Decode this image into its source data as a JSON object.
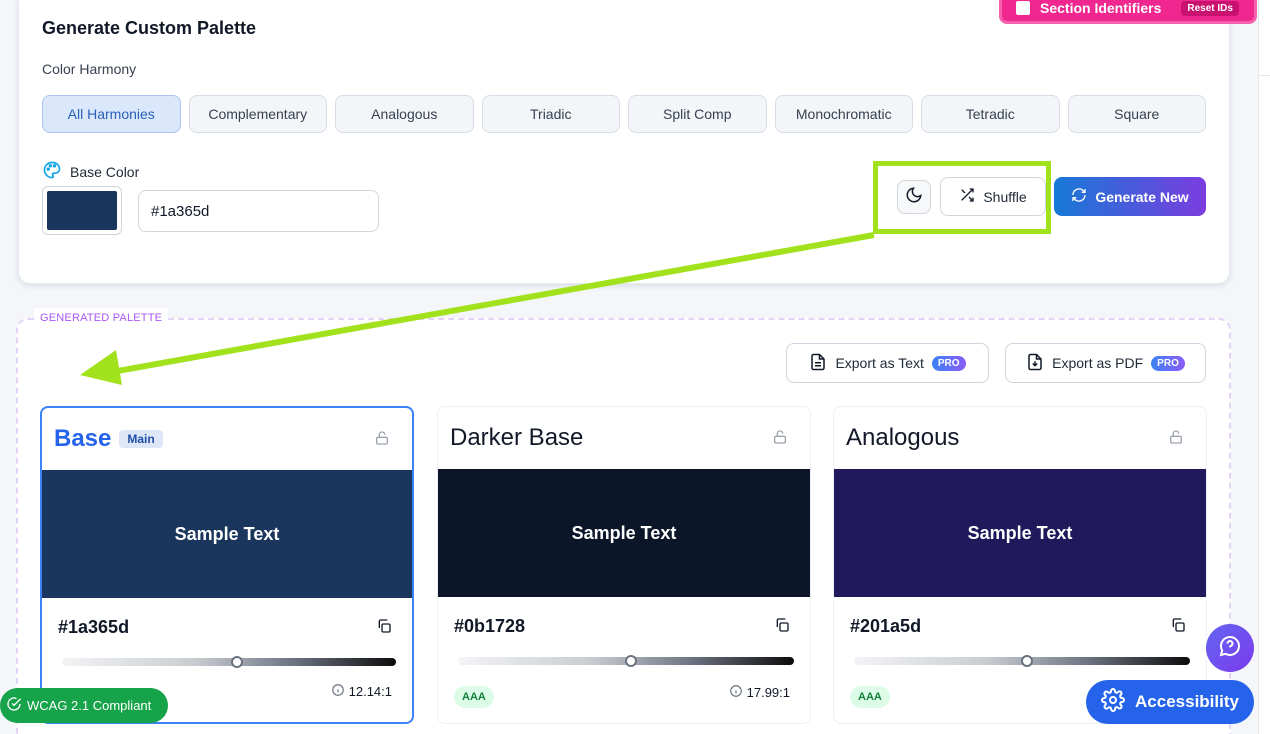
{
  "header": {
    "title": "Generate Custom Palette",
    "harmony_label": "Color Harmony",
    "harmonies": [
      {
        "label": "All Harmonies",
        "active": true
      },
      {
        "label": "Complementary",
        "active": false
      },
      {
        "label": "Analogous",
        "active": false
      },
      {
        "label": "Triadic",
        "active": false
      },
      {
        "label": "Split Comp",
        "active": false
      },
      {
        "label": "Monochromatic",
        "active": false
      },
      {
        "label": "Tetradic",
        "active": false
      },
      {
        "label": "Square",
        "active": false
      }
    ],
    "base_color_label": "Base Color",
    "base_color_value": "#1a365d",
    "shuffle_label": "Shuffle",
    "generate_label": "Generate New"
  },
  "section_identifiers": {
    "label": "Section Identifiers",
    "reset_label": "Reset IDs"
  },
  "palette": {
    "section_tag": "GENERATED PALETTE",
    "export_text_label": "Export as Text",
    "export_pdf_label": "Export as PDF",
    "pro_label": "PRO",
    "cards": [
      {
        "name": "Base",
        "badge": "Main",
        "color": "#1a365d",
        "hex": "#1a365d",
        "sample": "Sample Text",
        "rating": "",
        "ratio": "12.14:1",
        "slider": 0.5
      },
      {
        "name": "Darker Base",
        "badge": "",
        "color": "#0b1728",
        "hex": "#0b1728",
        "sample": "Sample Text",
        "rating": "AAA",
        "ratio": "17.99:1",
        "slider": 0.5
      },
      {
        "name": "Analogous",
        "badge": "",
        "color": "#201a5d",
        "hex": "#201a5d",
        "sample": "Sample Text",
        "rating": "AAA",
        "ratio": "",
        "slider": 0.5
      }
    ]
  },
  "floating": {
    "wcag_label": "WCAG 2.1 Compliant",
    "accessibility_label": "Accessibility"
  },
  "colors": {
    "annotation": "#a2e21d",
    "primary": "#2563eb",
    "accent_pink": "#f0278f"
  },
  "icons": [
    "palette-icon",
    "moon-icon",
    "shuffle-icon",
    "refresh-icon",
    "file-text-icon",
    "file-download-icon",
    "lock-icon",
    "copy-icon",
    "info-icon",
    "check-circle-icon",
    "help-chat-icon",
    "gear-icon"
  ]
}
